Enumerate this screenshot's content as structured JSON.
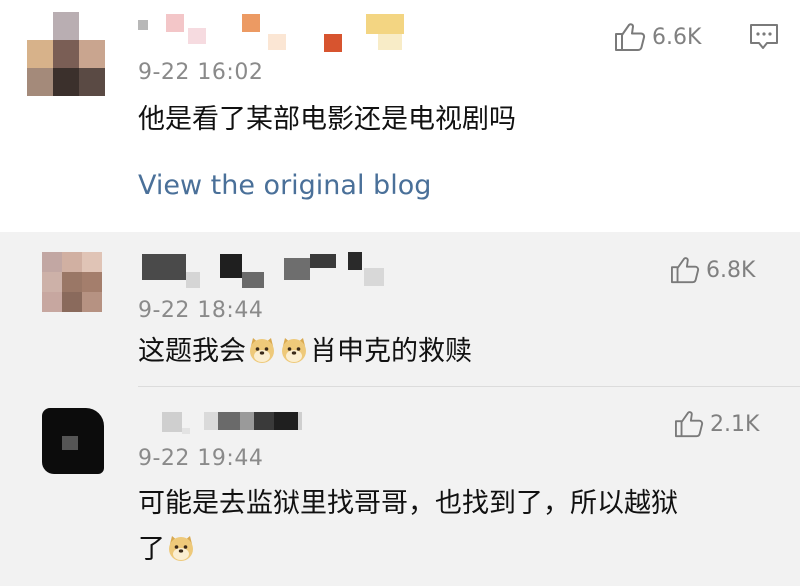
{
  "main": {
    "timestamp": "9-22 16:02",
    "text": "他是看了某部电影还是电视剧吗",
    "likes": "6.6K",
    "view_link": "View the original blog",
    "like_icon": "thumbs-up-icon",
    "comment_icon": "comment-icon"
  },
  "replies": [
    {
      "timestamp": "9-22 18:44",
      "text_before": "这题我会",
      "emoji": "doge-emoji",
      "text_after": "肖申克的救赎",
      "likes": "6.8K"
    },
    {
      "timestamp": "9-22 19:44",
      "text_line1": "可能是去监狱里找哥哥，也找到了，所以越狱",
      "text_line2": "了",
      "emoji": "doge-emoji",
      "likes": "2.1K"
    }
  ],
  "colors": {
    "link": "#4a7099",
    "meta": "#8a8a8a",
    "reply_bg": "#f2f2f2"
  }
}
